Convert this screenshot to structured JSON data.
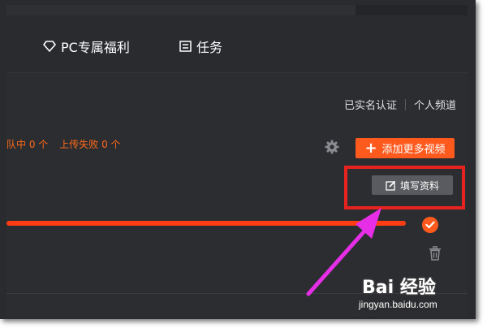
{
  "nav": {
    "pc_benefits": "PC专属福利",
    "tasks": "任务"
  },
  "header_links": {
    "verified": "已实名认证",
    "personal_channel": "个人频道"
  },
  "status": {
    "uploading": "队中 0 个",
    "failed": "上传失败 0 个"
  },
  "buttons": {
    "add_more_videos": "添加更多视频",
    "fill_info": "填写资料"
  },
  "upload": {
    "progress": 1.0,
    "complete": true
  },
  "colors": {
    "accent_orange": "#ff5a1e",
    "highlight_red": "#e8231f",
    "arrow_magenta": "#e62ee6",
    "background": "#2c2d31"
  },
  "icons": {
    "pc_benefits": "diamond-icon",
    "tasks": "task-list-icon",
    "settings": "gear-icon",
    "fill_info": "edit-icon",
    "done": "check-icon",
    "delete": "trash-icon"
  },
  "watermark": {
    "logo": "Bai 经验",
    "url": "jingyan.baidu.com"
  }
}
